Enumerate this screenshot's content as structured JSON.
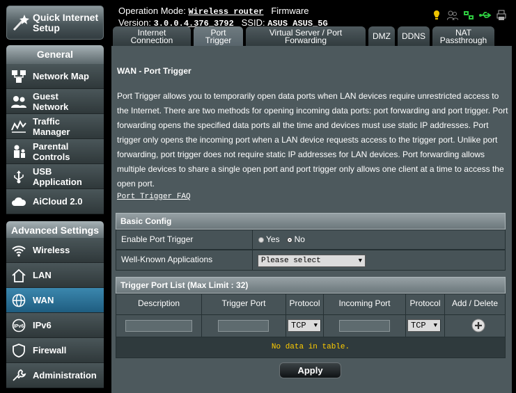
{
  "quick_setup": {
    "label_line1": "Quick Internet",
    "label_line2": "Setup"
  },
  "sidebar": {
    "general_title": "General",
    "general_items": [
      {
        "label1": "Network Map",
        "label2": "",
        "icon": "network-map-icon"
      },
      {
        "label1": "Guest",
        "label2": "Network",
        "icon": "guest-network-icon"
      },
      {
        "label1": "Traffic",
        "label2": "Manager",
        "icon": "traffic-manager-icon"
      },
      {
        "label1": "Parental",
        "label2": "Controls",
        "icon": "parental-controls-icon"
      },
      {
        "label1": "USB",
        "label2": "Application",
        "icon": "usb-application-icon"
      },
      {
        "label1": "AiCloud 2.0",
        "label2": "",
        "icon": "aicloud-icon"
      }
    ],
    "advanced_title": "Advanced Settings",
    "advanced_items": [
      {
        "label": "Wireless",
        "icon": "wireless-icon",
        "active": false
      },
      {
        "label": "LAN",
        "icon": "lan-icon",
        "active": false
      },
      {
        "label": "WAN",
        "icon": "wan-icon",
        "active": true
      },
      {
        "label": "IPv6",
        "icon": "ipv6-icon",
        "active": false
      },
      {
        "label": "Firewall",
        "icon": "firewall-icon",
        "active": false
      },
      {
        "label": "Administration",
        "icon": "administration-icon",
        "active": false
      }
    ]
  },
  "header": {
    "operation_mode_label": "Operation Mode:",
    "operation_mode_value": "Wireless router",
    "firmware_label": "Firmware",
    "version_label": "Version:",
    "version_value": "3.0.0.4.376_3792",
    "ssid_label": "SSID:",
    "ssid_value": "ASUS ASUS_5G",
    "status_icons": [
      "notification-icon",
      "clients-icon",
      "network-status-icon",
      "usb-status-icon",
      "printer-icon"
    ]
  },
  "tabs": [
    {
      "line1": "Internet",
      "line2": "Connection",
      "active": false
    },
    {
      "line1": "Port",
      "line2": "Trigger",
      "active": true
    },
    {
      "line1": "Virtual Server / Port",
      "line2": "Forwarding",
      "active": false
    },
    {
      "line1": "DMZ",
      "line2": "",
      "active": false
    },
    {
      "line1": "DDNS",
      "line2": "",
      "active": false
    },
    {
      "line1": "NAT",
      "line2": "Passthrough",
      "active": false
    }
  ],
  "page": {
    "title": "WAN - Port Trigger",
    "description": "Port Trigger allows you to temporarily open data ports when LAN devices require unrestricted access to the Internet. There are two methods for opening incoming data ports: port forwarding and port trigger. Port forwarding opens the specified data ports all the time and devices must use static IP addresses. Port trigger only opens the incoming port when a LAN device requests access to the trigger port. Unlike port forwarding, port trigger does not require static IP addresses for LAN devices. Port forwarding allows multiple devices to share a single open port and port trigger only allows one client at a time to access the open port.",
    "faq_link": "Port Trigger FAQ"
  },
  "basic_config": {
    "title": "Basic Config",
    "enable_label": "Enable Port Trigger",
    "yes_label": "Yes",
    "no_label": "No",
    "selected": "No",
    "apps_label": "Well-Known Applications",
    "apps_value": "Please select"
  },
  "trigger_list": {
    "title": "Trigger Port List (Max Limit : 32)",
    "columns": [
      "Description",
      "Trigger Port",
      "Protocol",
      "Incoming Port",
      "Protocol",
      "Add / Delete"
    ],
    "protocol_value_1": "TCP",
    "protocol_value_2": "TCP",
    "empty_text": "No data in table."
  },
  "apply_label": "Apply"
}
